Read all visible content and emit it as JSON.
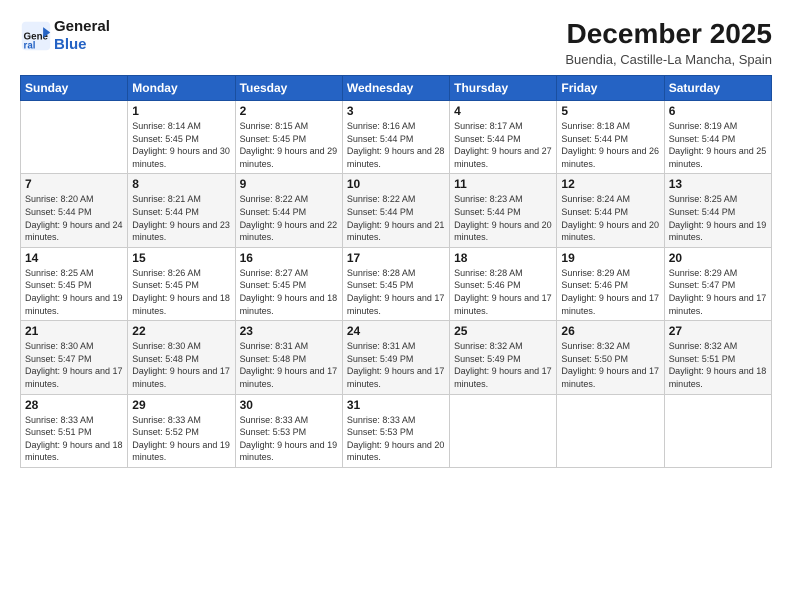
{
  "logo": {
    "line1": "General",
    "line2": "Blue"
  },
  "title": "December 2025",
  "subtitle": "Buendia, Castille-La Mancha, Spain",
  "headers": [
    "Sunday",
    "Monday",
    "Tuesday",
    "Wednesday",
    "Thursday",
    "Friday",
    "Saturday"
  ],
  "weeks": [
    [
      {
        "day": "",
        "sunrise": "",
        "sunset": "",
        "daylight": ""
      },
      {
        "day": "1",
        "sunrise": "Sunrise: 8:14 AM",
        "sunset": "Sunset: 5:45 PM",
        "daylight": "Daylight: 9 hours and 30 minutes."
      },
      {
        "day": "2",
        "sunrise": "Sunrise: 8:15 AM",
        "sunset": "Sunset: 5:45 PM",
        "daylight": "Daylight: 9 hours and 29 minutes."
      },
      {
        "day": "3",
        "sunrise": "Sunrise: 8:16 AM",
        "sunset": "Sunset: 5:44 PM",
        "daylight": "Daylight: 9 hours and 28 minutes."
      },
      {
        "day": "4",
        "sunrise": "Sunrise: 8:17 AM",
        "sunset": "Sunset: 5:44 PM",
        "daylight": "Daylight: 9 hours and 27 minutes."
      },
      {
        "day": "5",
        "sunrise": "Sunrise: 8:18 AM",
        "sunset": "Sunset: 5:44 PM",
        "daylight": "Daylight: 9 hours and 26 minutes."
      },
      {
        "day": "6",
        "sunrise": "Sunrise: 8:19 AM",
        "sunset": "Sunset: 5:44 PM",
        "daylight": "Daylight: 9 hours and 25 minutes."
      }
    ],
    [
      {
        "day": "7",
        "sunrise": "Sunrise: 8:20 AM",
        "sunset": "Sunset: 5:44 PM",
        "daylight": "Daylight: 9 hours and 24 minutes."
      },
      {
        "day": "8",
        "sunrise": "Sunrise: 8:21 AM",
        "sunset": "Sunset: 5:44 PM",
        "daylight": "Daylight: 9 hours and 23 minutes."
      },
      {
        "day": "9",
        "sunrise": "Sunrise: 8:22 AM",
        "sunset": "Sunset: 5:44 PM",
        "daylight": "Daylight: 9 hours and 22 minutes."
      },
      {
        "day": "10",
        "sunrise": "Sunrise: 8:22 AM",
        "sunset": "Sunset: 5:44 PM",
        "daylight": "Daylight: 9 hours and 21 minutes."
      },
      {
        "day": "11",
        "sunrise": "Sunrise: 8:23 AM",
        "sunset": "Sunset: 5:44 PM",
        "daylight": "Daylight: 9 hours and 20 minutes."
      },
      {
        "day": "12",
        "sunrise": "Sunrise: 8:24 AM",
        "sunset": "Sunset: 5:44 PM",
        "daylight": "Daylight: 9 hours and 20 minutes."
      },
      {
        "day": "13",
        "sunrise": "Sunrise: 8:25 AM",
        "sunset": "Sunset: 5:44 PM",
        "daylight": "Daylight: 9 hours and 19 minutes."
      }
    ],
    [
      {
        "day": "14",
        "sunrise": "Sunrise: 8:25 AM",
        "sunset": "Sunset: 5:45 PM",
        "daylight": "Daylight: 9 hours and 19 minutes."
      },
      {
        "day": "15",
        "sunrise": "Sunrise: 8:26 AM",
        "sunset": "Sunset: 5:45 PM",
        "daylight": "Daylight: 9 hours and 18 minutes."
      },
      {
        "day": "16",
        "sunrise": "Sunrise: 8:27 AM",
        "sunset": "Sunset: 5:45 PM",
        "daylight": "Daylight: 9 hours and 18 minutes."
      },
      {
        "day": "17",
        "sunrise": "Sunrise: 8:28 AM",
        "sunset": "Sunset: 5:45 PM",
        "daylight": "Daylight: 9 hours and 17 minutes."
      },
      {
        "day": "18",
        "sunrise": "Sunrise: 8:28 AM",
        "sunset": "Sunset: 5:46 PM",
        "daylight": "Daylight: 9 hours and 17 minutes."
      },
      {
        "day": "19",
        "sunrise": "Sunrise: 8:29 AM",
        "sunset": "Sunset: 5:46 PM",
        "daylight": "Daylight: 9 hours and 17 minutes."
      },
      {
        "day": "20",
        "sunrise": "Sunrise: 8:29 AM",
        "sunset": "Sunset: 5:47 PM",
        "daylight": "Daylight: 9 hours and 17 minutes."
      }
    ],
    [
      {
        "day": "21",
        "sunrise": "Sunrise: 8:30 AM",
        "sunset": "Sunset: 5:47 PM",
        "daylight": "Daylight: 9 hours and 17 minutes."
      },
      {
        "day": "22",
        "sunrise": "Sunrise: 8:30 AM",
        "sunset": "Sunset: 5:48 PM",
        "daylight": "Daylight: 9 hours and 17 minutes."
      },
      {
        "day": "23",
        "sunrise": "Sunrise: 8:31 AM",
        "sunset": "Sunset: 5:48 PM",
        "daylight": "Daylight: 9 hours and 17 minutes."
      },
      {
        "day": "24",
        "sunrise": "Sunrise: 8:31 AM",
        "sunset": "Sunset: 5:49 PM",
        "daylight": "Daylight: 9 hours and 17 minutes."
      },
      {
        "day": "25",
        "sunrise": "Sunrise: 8:32 AM",
        "sunset": "Sunset: 5:49 PM",
        "daylight": "Daylight: 9 hours and 17 minutes."
      },
      {
        "day": "26",
        "sunrise": "Sunrise: 8:32 AM",
        "sunset": "Sunset: 5:50 PM",
        "daylight": "Daylight: 9 hours and 17 minutes."
      },
      {
        "day": "27",
        "sunrise": "Sunrise: 8:32 AM",
        "sunset": "Sunset: 5:51 PM",
        "daylight": "Daylight: 9 hours and 18 minutes."
      }
    ],
    [
      {
        "day": "28",
        "sunrise": "Sunrise: 8:33 AM",
        "sunset": "Sunset: 5:51 PM",
        "daylight": "Daylight: 9 hours and 18 minutes."
      },
      {
        "day": "29",
        "sunrise": "Sunrise: 8:33 AM",
        "sunset": "Sunset: 5:52 PM",
        "daylight": "Daylight: 9 hours and 19 minutes."
      },
      {
        "day": "30",
        "sunrise": "Sunrise: 8:33 AM",
        "sunset": "Sunset: 5:53 PM",
        "daylight": "Daylight: 9 hours and 19 minutes."
      },
      {
        "day": "31",
        "sunrise": "Sunrise: 8:33 AM",
        "sunset": "Sunset: 5:53 PM",
        "daylight": "Daylight: 9 hours and 20 minutes."
      },
      {
        "day": "",
        "sunrise": "",
        "sunset": "",
        "daylight": ""
      },
      {
        "day": "",
        "sunrise": "",
        "sunset": "",
        "daylight": ""
      },
      {
        "day": "",
        "sunrise": "",
        "sunset": "",
        "daylight": ""
      }
    ]
  ]
}
